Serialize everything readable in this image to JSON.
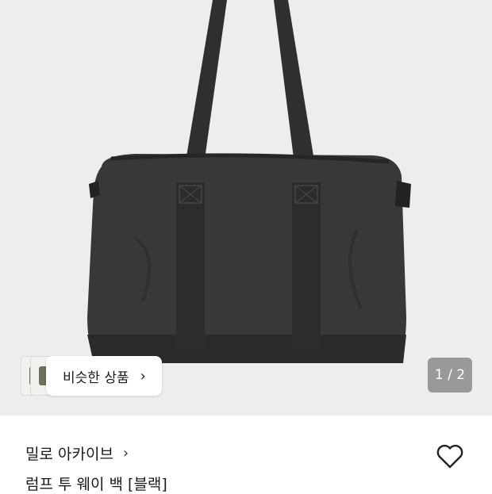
{
  "gallery": {
    "counter": "1 / 2",
    "similar_products_label": "비슷한 상품",
    "similar_thumbs": [
      "#6a6a5e",
      "#6e6f5c"
    ]
  },
  "product": {
    "brand": "밀로 아카이브",
    "name": "럼프 투 웨이 백 [블랙]"
  },
  "icons": {
    "similar_chevron": "chevron-right-icon",
    "brand_chevron": "chevron-right-icon",
    "wishlist": "heart-outline-icon"
  },
  "colors": {
    "hero_background": "#ededed",
    "bag": "#333333"
  }
}
